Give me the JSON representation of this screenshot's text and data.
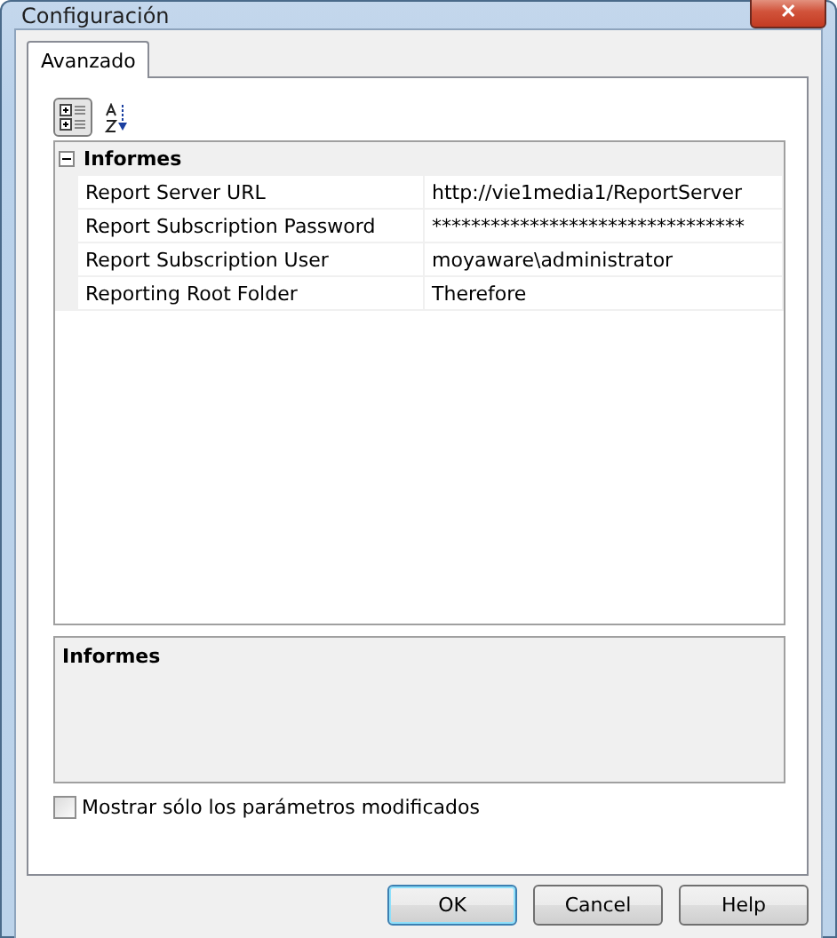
{
  "window": {
    "title": "Configuración",
    "close": "✕"
  },
  "tabs": [
    {
      "label": "Avanzado",
      "selected": true
    }
  ],
  "toolbar": [
    {
      "kind": "categorized",
      "selected": true
    },
    {
      "kind": "alphabetical",
      "selected": false
    }
  ],
  "grid": {
    "category": {
      "name": "Informes",
      "expanded": true
    },
    "rows": [
      {
        "name": "Report Server URL",
        "value": "http://vie1media1/ReportServer"
      },
      {
        "name": "Report Subscription Password",
        "value": "********************************"
      },
      {
        "name": "Report Subscription User",
        "value": "moyaware\\administrator"
      },
      {
        "name": "Reporting Root Folder",
        "value": "Therefore"
      }
    ]
  },
  "description": {
    "title": "Informes"
  },
  "show_modified_only": {
    "label": "Mostrar sólo los parámetros modificados",
    "checked": false
  },
  "buttons": [
    {
      "label": "OK",
      "default": true
    },
    {
      "label": "Cancel",
      "default": false
    },
    {
      "label": "Help",
      "default": false
    }
  ]
}
